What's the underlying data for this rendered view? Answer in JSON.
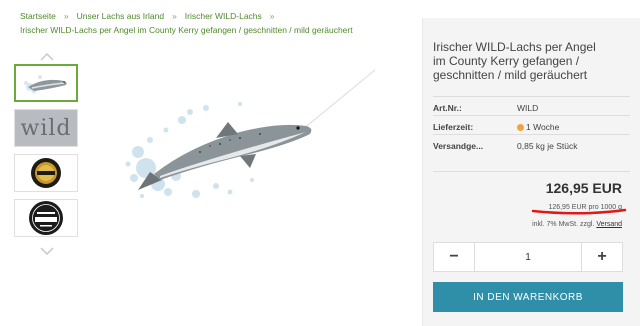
{
  "breadcrumb": {
    "items": [
      "Startseite",
      "Unser Lachs aus Irland",
      "Irischer WILD-Lachs"
    ],
    "separator": "»",
    "current": "Irischer WILD-Lachs per Angel im County Kerry gefangen / geschnitten / mild geräuchert"
  },
  "product": {
    "title": "Irischer WILD-Lachs per Angel im County Kerry gefangen / geschnitten / mild geräuchert",
    "specs": [
      {
        "key": "Art.Nr.:",
        "value": "WILD"
      },
      {
        "key": "Lieferzeit:",
        "value": "1 Woche",
        "icon": "delivery-status-dot"
      },
      {
        "key": "Versandge...",
        "value": "0,85 kg je Stück"
      }
    ],
    "price": "126,95 EUR",
    "base_price": "126,95 EUR pro 1000 g",
    "tax_note": "inkl. 7% MwSt. zzgl.",
    "shipping_link": "Versand",
    "quantity": "1",
    "add_to_cart": "IN DEN WARENKORB"
  },
  "thumbnails": {
    "wild_label": "wild",
    "items": [
      "salmon-jump-thumb",
      "wild-text-thumb",
      "quality-seal-thumb",
      "great-taste-badge-thumb"
    ]
  },
  "colors": {
    "breadcrumb_link": "#4f8a2a",
    "accent_button": "#2f8fa8",
    "annotation_red": "#e01a1a",
    "panel_bg": "#f4f4f4"
  }
}
